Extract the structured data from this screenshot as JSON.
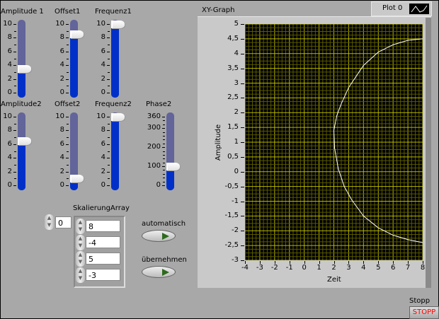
{
  "sliders": [
    {
      "id": "amplitude1",
      "label": "Amplitude 1",
      "value": 3.5,
      "min": 0,
      "max": 10,
      "ticks": [
        "10",
        "8",
        "6",
        "4",
        "2",
        "0"
      ]
    },
    {
      "id": "offset1",
      "label": "Offset1",
      "value": 8.6,
      "min": 0,
      "max": 10,
      "ticks": [
        "10",
        "8",
        "6",
        "4",
        "2",
        "0"
      ]
    },
    {
      "id": "frequenz1",
      "label": "Frequenz1",
      "value": 10,
      "min": 0,
      "max": 10,
      "ticks": [
        "10",
        "8",
        "6",
        "4",
        "2",
        "0"
      ]
    },
    {
      "id": "amplitude2",
      "label": "Amplitude2",
      "value": 6.5,
      "min": 0,
      "max": 10,
      "ticks": [
        "10",
        "8",
        "6",
        "4",
        "2",
        "0"
      ]
    },
    {
      "id": "offset2",
      "label": "Offset2",
      "value": 1,
      "min": 0,
      "max": 10,
      "ticks": [
        "10",
        "8",
        "6",
        "4",
        "2",
        "0"
      ]
    },
    {
      "id": "frequenz2",
      "label": "Frequenz2",
      "value": 10,
      "min": 0,
      "max": 10,
      "ticks": [
        "10",
        "8",
        "6",
        "4",
        "2",
        "0"
      ]
    },
    {
      "id": "phase2",
      "label": "Phase2",
      "value": 100,
      "min": 0,
      "max": 360,
      "ticks": [
        "360",
        "300",
        "200",
        "100",
        "0"
      ]
    }
  ],
  "array": {
    "label": "SkalierungArray",
    "index": "0",
    "values": [
      "8",
      "-4",
      "5",
      "-3"
    ]
  },
  "buttons": {
    "auto_label": "automatisch",
    "apply_label": "übernehmen",
    "stop_label": "Stopp",
    "stop_text": "STOPP"
  },
  "graph": {
    "title": "XY-Graph",
    "legend": "Plot 0"
  },
  "chart_data": {
    "type": "line",
    "title": "XY-Graph",
    "xlabel": "Zeit",
    "ylabel": "Amplitude",
    "xlim": [
      -4,
      8
    ],
    "ylim": [
      -3,
      5
    ],
    "grid": true,
    "xticks": [
      "-4",
      "-3",
      "-2",
      "-1",
      "0",
      "1",
      "2",
      "3",
      "4",
      "5",
      "6",
      "7",
      "8"
    ],
    "yticks": [
      "5",
      "4,5",
      "4",
      "3,5",
      "3",
      "2,5",
      "2",
      "1,5",
      "1",
      "0,5",
      "0",
      "-0,5",
      "-1",
      "-1,5",
      "-2",
      "-2,5",
      "-3"
    ],
    "series": [
      {
        "name": "Plot 0",
        "color": "#ffffff",
        "x": [
          8,
          7,
          6,
          5,
          4,
          3,
          2.5,
          2.2,
          2,
          2.05,
          2.3,
          2.7,
          3.2,
          4,
          5,
          6,
          7,
          8
        ],
        "y": [
          4.5,
          4.45,
          4.3,
          4.05,
          3.6,
          2.85,
          2.3,
          1.9,
          1.4,
          0.8,
          0.1,
          -0.5,
          -0.95,
          -1.5,
          -1.9,
          -2.15,
          -2.3,
          -2.4
        ]
      }
    ],
    "colors": {
      "background": "#000000",
      "grid_major": "#b8b800",
      "grid_minor": "#5a5a00"
    }
  }
}
